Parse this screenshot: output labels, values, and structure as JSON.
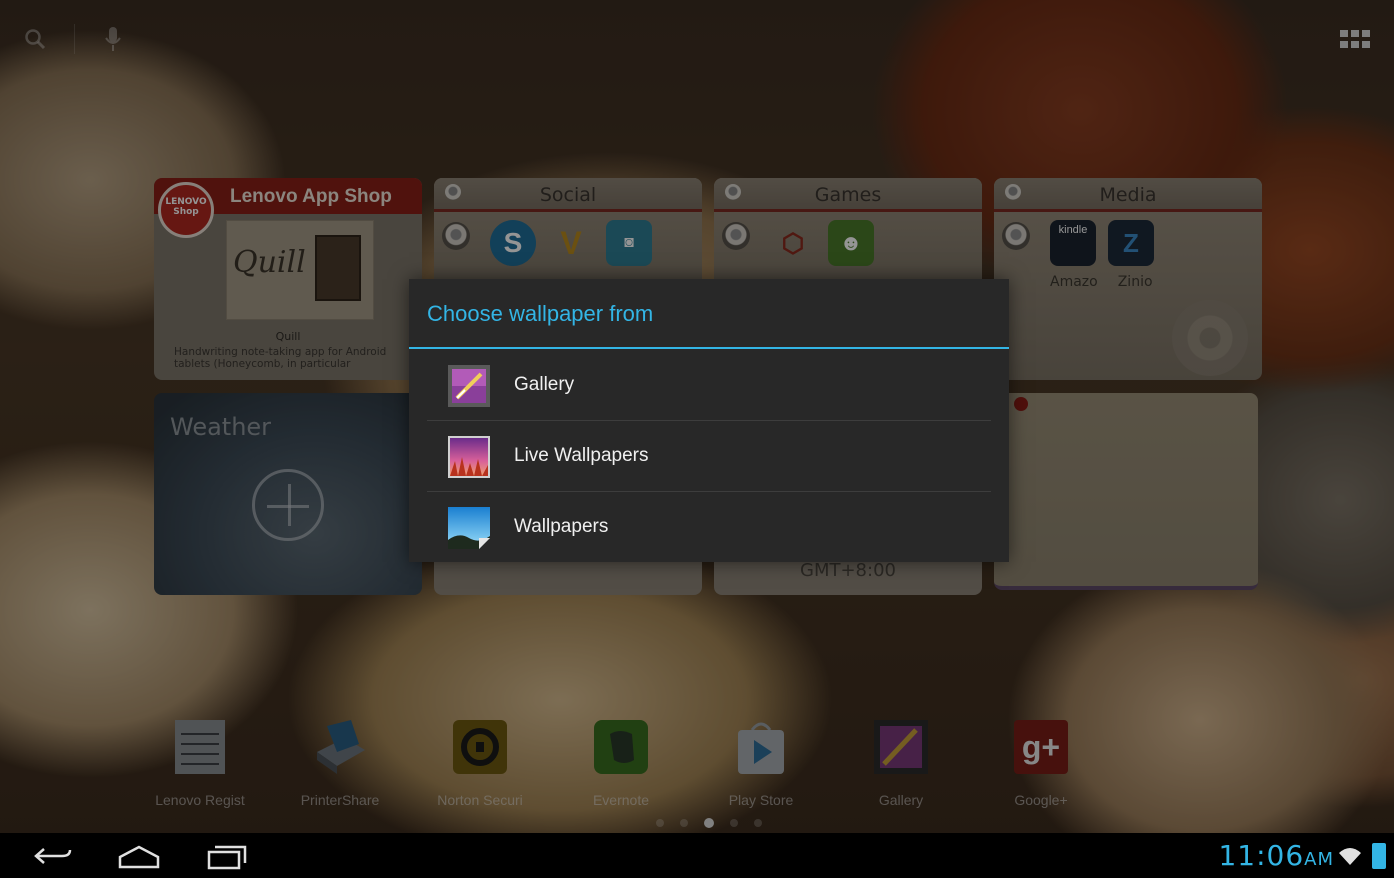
{
  "dialog": {
    "title": "Choose wallpaper from",
    "options": [
      {
        "label": "Gallery",
        "icon": "gallery-icon"
      },
      {
        "label": "Live Wallpapers",
        "icon": "live-wallpapers-icon"
      },
      {
        "label": "Wallpapers",
        "icon": "wallpapers-icon"
      }
    ],
    "accent_color": "#33b5e5"
  },
  "widgets": {
    "app_shop": {
      "logo_text": "LENOVO Shop",
      "title": "Lenovo App Shop",
      "art_word": "Quill",
      "app_name": "Quill",
      "app_description": "Handwriting note-taking app for Android tablets (Honeycomb, in particular"
    },
    "social": {
      "title": "Social"
    },
    "games": {
      "title": "Games"
    },
    "media": {
      "title": "Media",
      "labels": [
        "Amazo",
        "Zinio"
      ],
      "icon_text": "kindle"
    },
    "weather": {
      "title": "Weather"
    },
    "clock": {
      "timezone": "GMT+8:00"
    }
  },
  "dock": {
    "items": [
      {
        "label": "Lenovo Regist",
        "icon": "lenovo-registration-icon"
      },
      {
        "label": "PrinterShare",
        "icon": "printershare-icon"
      },
      {
        "label": "Norton Securi",
        "icon": "norton-security-icon"
      },
      {
        "label": "Evernote",
        "icon": "evernote-icon"
      },
      {
        "label": "Play Store",
        "icon": "play-store-icon"
      },
      {
        "label": "Gallery",
        "icon": "gallery-icon"
      },
      {
        "label": "Google+",
        "icon": "google-plus-icon"
      }
    ]
  },
  "statusbar": {
    "time": "11:06",
    "ampm": "AM",
    "clock_color": "#33b5e5"
  }
}
